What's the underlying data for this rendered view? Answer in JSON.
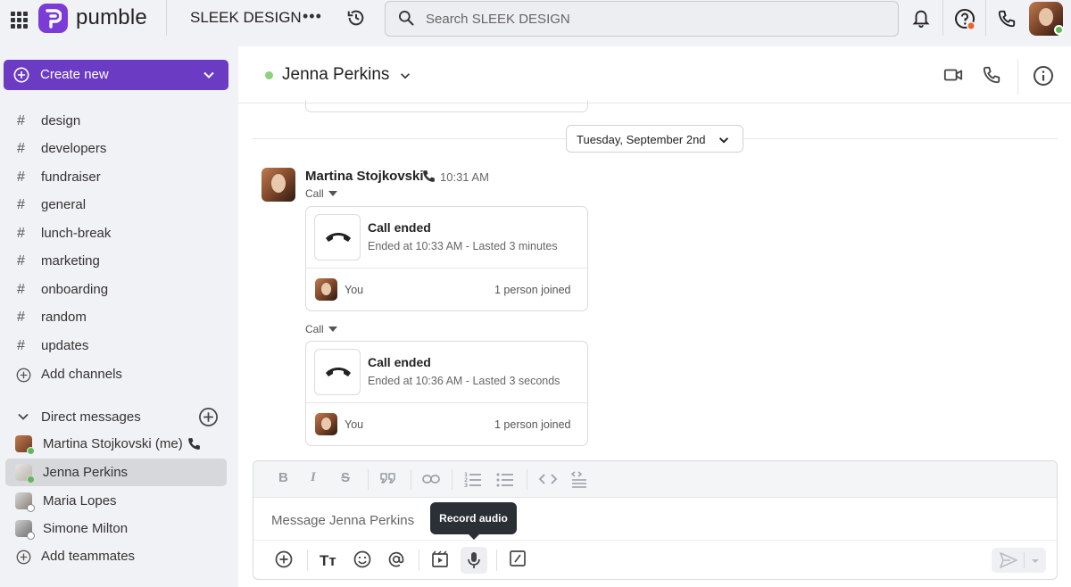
{
  "app": {
    "brand": "pumble",
    "workspace": "SLEEK DESIGN",
    "more_label": "•••"
  },
  "search": {
    "placeholder": "Search SLEEK DESIGN"
  },
  "sidebar": {
    "create_label": "Create new",
    "channels": [
      {
        "label": "design"
      },
      {
        "label": "developers"
      },
      {
        "label": "fundraiser"
      },
      {
        "label": "general"
      },
      {
        "label": "lunch-break"
      },
      {
        "label": "marketing"
      },
      {
        "label": "onboarding"
      },
      {
        "label": "random"
      },
      {
        "label": "updates"
      }
    ],
    "add_channels_label": "Add channels",
    "dm_header": "Direct messages",
    "dms": [
      {
        "label": "Martina Stojkovski (me)"
      },
      {
        "label": "Jenna Perkins"
      },
      {
        "label": "Maria Lopes"
      },
      {
        "label": "Simone Milton"
      }
    ],
    "add_teammates_label": "Add teammates"
  },
  "chat": {
    "title": "Jenna Perkins",
    "date_label": "Tuesday, September 2nd",
    "sender": "Martina Stojkovski",
    "time": "10:31 AM",
    "calls": [
      {
        "tag": "Call",
        "title": "Call ended",
        "subtitle": "Ended at 10:33 AM - Lasted 3 minutes",
        "participant": "You",
        "joined": "1 person joined"
      },
      {
        "tag": "Call",
        "title": "Call ended",
        "subtitle": "Ended at 10:36 AM - Lasted 3 seconds",
        "participant": "You",
        "joined": "1 person joined"
      }
    ]
  },
  "composer": {
    "placeholder": "Message Jenna Perkins",
    "tooltip": "Record audio",
    "bold": "B",
    "italic": "I",
    "strike": "S",
    "text_size": "Tт"
  },
  "colors": {
    "brand": "#7a3bd6",
    "create_button": "#6b3bc3",
    "online": "#5fb85a",
    "away": "#e8642c"
  }
}
